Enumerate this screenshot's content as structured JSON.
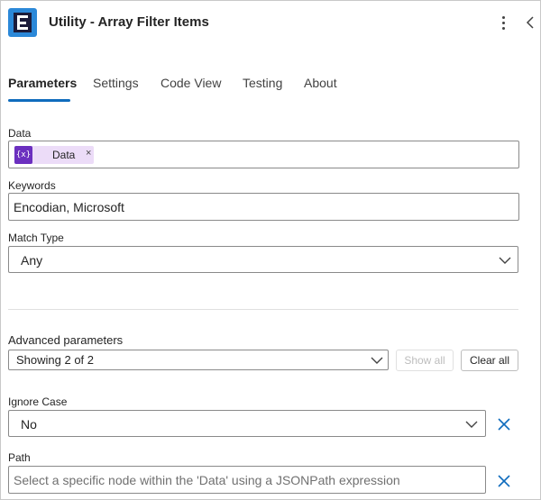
{
  "header": {
    "title": "Utility - Array Filter Items",
    "more_icon": "more-vertical-icon",
    "collapse_icon": "chevron-left-icon"
  },
  "tabs": [
    {
      "label": "Parameters",
      "active": true
    },
    {
      "label": "Settings"
    },
    {
      "label": "Code View"
    },
    {
      "label": "Testing"
    },
    {
      "label": "About"
    }
  ],
  "fields": {
    "data": {
      "label": "Data",
      "token_icon_text": "{x}",
      "token_label": "Data",
      "token_remove": "×"
    },
    "keywords": {
      "label": "Keywords",
      "value": "Encodian,  Microsoft"
    },
    "match_type": {
      "label": "Match Type",
      "value": "Any"
    }
  },
  "advanced": {
    "label": "Advanced parameters",
    "selected": "Showing 2 of 2",
    "show_all": "Show all",
    "clear_all": "Clear all"
  },
  "ignore_case": {
    "label": "Ignore Case",
    "value": "No"
  },
  "path": {
    "label": "Path",
    "placeholder": "Select a specific node within the 'Data' using a JSONPath expression"
  },
  "colors": {
    "accent": "#0f6cbd",
    "token_bg": "#ecdcf8",
    "token_icon": "#6b2fbf",
    "remove_x": "#0f6cbd"
  }
}
